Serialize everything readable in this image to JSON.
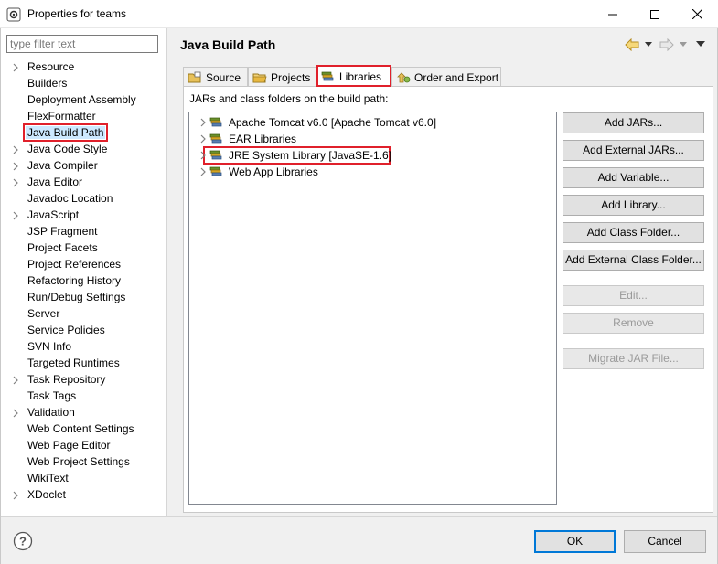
{
  "window": {
    "title": "Properties for teams",
    "icon": "properties-gear-icon"
  },
  "filter": {
    "placeholder": "type filter text",
    "value": ""
  },
  "tree": {
    "items": [
      {
        "label": "Resource",
        "expandable": true
      },
      {
        "label": "Builders",
        "expandable": false
      },
      {
        "label": "Deployment Assembly",
        "expandable": false
      },
      {
        "label": "FlexFormatter",
        "expandable": false
      },
      {
        "label": "Java Build Path",
        "expandable": false,
        "selected": true
      },
      {
        "label": "Java Code Style",
        "expandable": true
      },
      {
        "label": "Java Compiler",
        "expandable": true
      },
      {
        "label": "Java Editor",
        "expandable": true
      },
      {
        "label": "Javadoc Location",
        "expandable": false
      },
      {
        "label": "JavaScript",
        "expandable": true
      },
      {
        "label": "JSP Fragment",
        "expandable": false
      },
      {
        "label": "Project Facets",
        "expandable": false
      },
      {
        "label": "Project References",
        "expandable": false
      },
      {
        "label": "Refactoring History",
        "expandable": false
      },
      {
        "label": "Run/Debug Settings",
        "expandable": false
      },
      {
        "label": "Server",
        "expandable": false
      },
      {
        "label": "Service Policies",
        "expandable": false
      },
      {
        "label": "SVN Info",
        "expandable": false
      },
      {
        "label": "Targeted Runtimes",
        "expandable": false
      },
      {
        "label": "Task Repository",
        "expandable": true
      },
      {
        "label": "Task Tags",
        "expandable": false
      },
      {
        "label": "Validation",
        "expandable": true
      },
      {
        "label": "Web Content Settings",
        "expandable": false
      },
      {
        "label": "Web Page Editor",
        "expandable": false
      },
      {
        "label": "Web Project Settings",
        "expandable": false
      },
      {
        "label": "WikiText",
        "expandable": false
      },
      {
        "label": "XDoclet",
        "expandable": true
      }
    ]
  },
  "page": {
    "title": "Java Build Path"
  },
  "tabs": [
    {
      "label": "Source",
      "icon": "source-folder-icon"
    },
    {
      "label": "Projects",
      "icon": "projects-folder-icon"
    },
    {
      "label": "Libraries",
      "icon": "libraries-icon",
      "active": true
    },
    {
      "label": "Order and Export",
      "icon": "order-export-icon"
    }
  ],
  "libraries": {
    "caption": "JARs and class folders on the build path:",
    "items": [
      {
        "label": "Apache Tomcat v6.0 [Apache Tomcat v6.0]"
      },
      {
        "label": "EAR Libraries"
      },
      {
        "label": "JRE System Library [JavaSE-1.6]",
        "highlighted": true
      },
      {
        "label": "Web App Libraries"
      }
    ]
  },
  "buttons": {
    "add_jars": "Add JARs...",
    "add_external_jars": "Add External JARs...",
    "add_variable": "Add Variable...",
    "add_library": "Add Library...",
    "add_class_folder": "Add Class Folder...",
    "add_external_class_folder": "Add External Class Folder...",
    "edit": "Edit...",
    "remove": "Remove",
    "migrate_jar": "Migrate JAR File..."
  },
  "footer": {
    "ok": "OK",
    "cancel": "Cancel"
  },
  "colors": {
    "highlight_border": "#e0202b",
    "selection_bg": "#cce8ff",
    "default_button_border": "#0078d7"
  }
}
